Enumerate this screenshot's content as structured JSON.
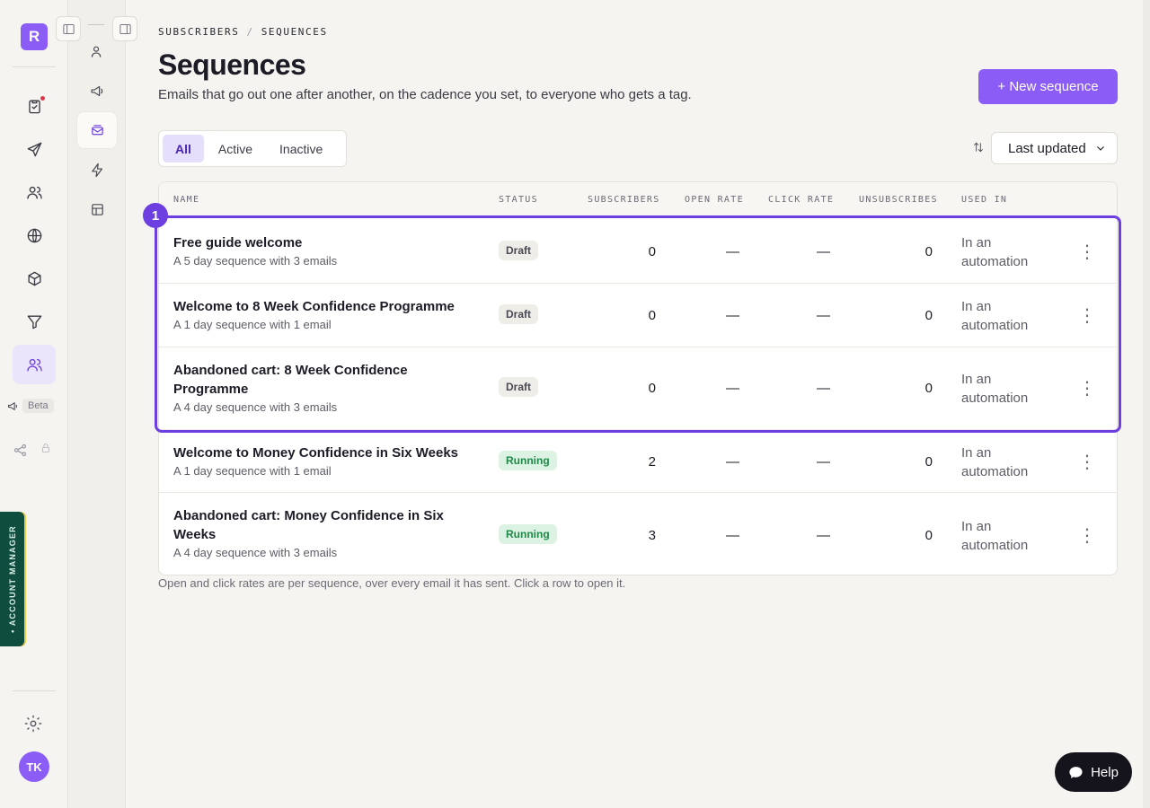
{
  "app": {
    "logo_letter": "R",
    "user_initials": "TK",
    "beta_label": "Beta",
    "account_manager_label": "• ACCOUNT MANAGER",
    "help_label": "Help"
  },
  "breadcrumb": {
    "parent": "SUBSCRIBERS",
    "separator": "/",
    "current": "SEQUENCES"
  },
  "header": {
    "title": "Sequences",
    "subtitle": "Emails that go out one after another, on the cadence you set, to everyone who gets a tag.",
    "new_button_label": "+ New sequence"
  },
  "filters": {
    "tabs": [
      "All",
      "Active",
      "Inactive"
    ],
    "active_tab": "All",
    "sort_value": "Last updated"
  },
  "table": {
    "columns": [
      "NAME",
      "STATUS",
      "SUBSCRIBERS",
      "OPEN RATE",
      "CLICK RATE",
      "UNSUBSCRIBES",
      "USED IN"
    ],
    "rows": [
      {
        "name": "Free guide welcome",
        "description": "A 5 day sequence with 3 emails",
        "status": "Draft",
        "subscribers": "0",
        "open_rate": "—",
        "click_rate": "—",
        "unsubscribes": "0",
        "used_in": "In an automation"
      },
      {
        "name": "Welcome to 8 Week Confidence Programme",
        "description": "A 1 day sequence with 1 email",
        "status": "Draft",
        "subscribers": "0",
        "open_rate": "—",
        "click_rate": "—",
        "unsubscribes": "0",
        "used_in": "In an automation"
      },
      {
        "name": "Abandoned cart: 8 Week Confidence Programme",
        "description": "A 4 day sequence with 3 emails",
        "status": "Draft",
        "subscribers": "0",
        "open_rate": "—",
        "click_rate": "—",
        "unsubscribes": "0",
        "used_in": "In an automation"
      },
      {
        "name": "Welcome to Money Confidence in Six Weeks",
        "description": "A 1 day sequence with 1 email",
        "status": "Running",
        "subscribers": "2",
        "open_rate": "—",
        "click_rate": "—",
        "unsubscribes": "0",
        "used_in": "In an automation"
      },
      {
        "name": "Abandoned cart: Money Confidence in Six Weeks",
        "description": "A 4 day sequence with 3 emails",
        "status": "Running",
        "subscribers": "3",
        "open_rate": "—",
        "click_rate": "—",
        "unsubscribes": "0",
        "used_in": "In an automation"
      }
    ]
  },
  "footnote": "Open and click rates are per sequence, over every email it has sent. Click a row to open it.",
  "annotation": {
    "marker": "1"
  },
  "colors": {
    "accent": "#8b5cf6",
    "draft_badge": "#efede8",
    "running_badge": "#dcf3e3"
  }
}
